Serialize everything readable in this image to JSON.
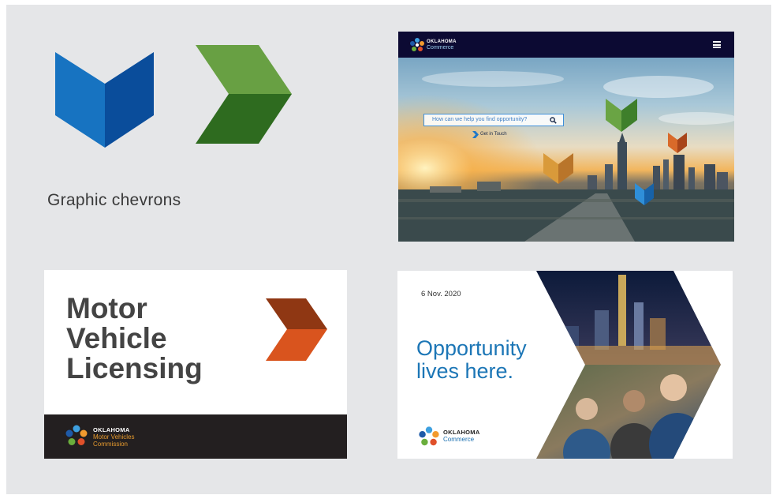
{
  "caption": "Graphic chevrons",
  "colors": {
    "blue_light": "#1773c1",
    "blue_dark": "#0a4d9b",
    "green_light": "#68a043",
    "green_dark": "#2e6b1f",
    "orange_dark": "#8f3713",
    "orange_light": "#d9541e",
    "navy": "#0c0a33",
    "text_blue": "#1c76b6"
  },
  "website": {
    "logo_line1": "OKLAHOMA",
    "logo_line2": "Commerce",
    "search_placeholder": "How can we help you find opportunity?",
    "cta": "Get in Touch",
    "icons": [
      "menu-icon",
      "search-icon",
      "arrow-right-icon"
    ]
  },
  "motor_vehicle": {
    "title_lines": [
      "Motor",
      "Vehicle",
      "Licensing"
    ],
    "logo_line1": "OKLAHOMA",
    "logo_line2": "Motor Vehicles",
    "logo_line3": "Commission"
  },
  "opportunity": {
    "date": "6 Nov. 2020",
    "headline_line1": "Opportunity",
    "headline_line2": "lives here.",
    "logo_line1": "OKLAHOMA",
    "logo_line2": "Commerce"
  }
}
